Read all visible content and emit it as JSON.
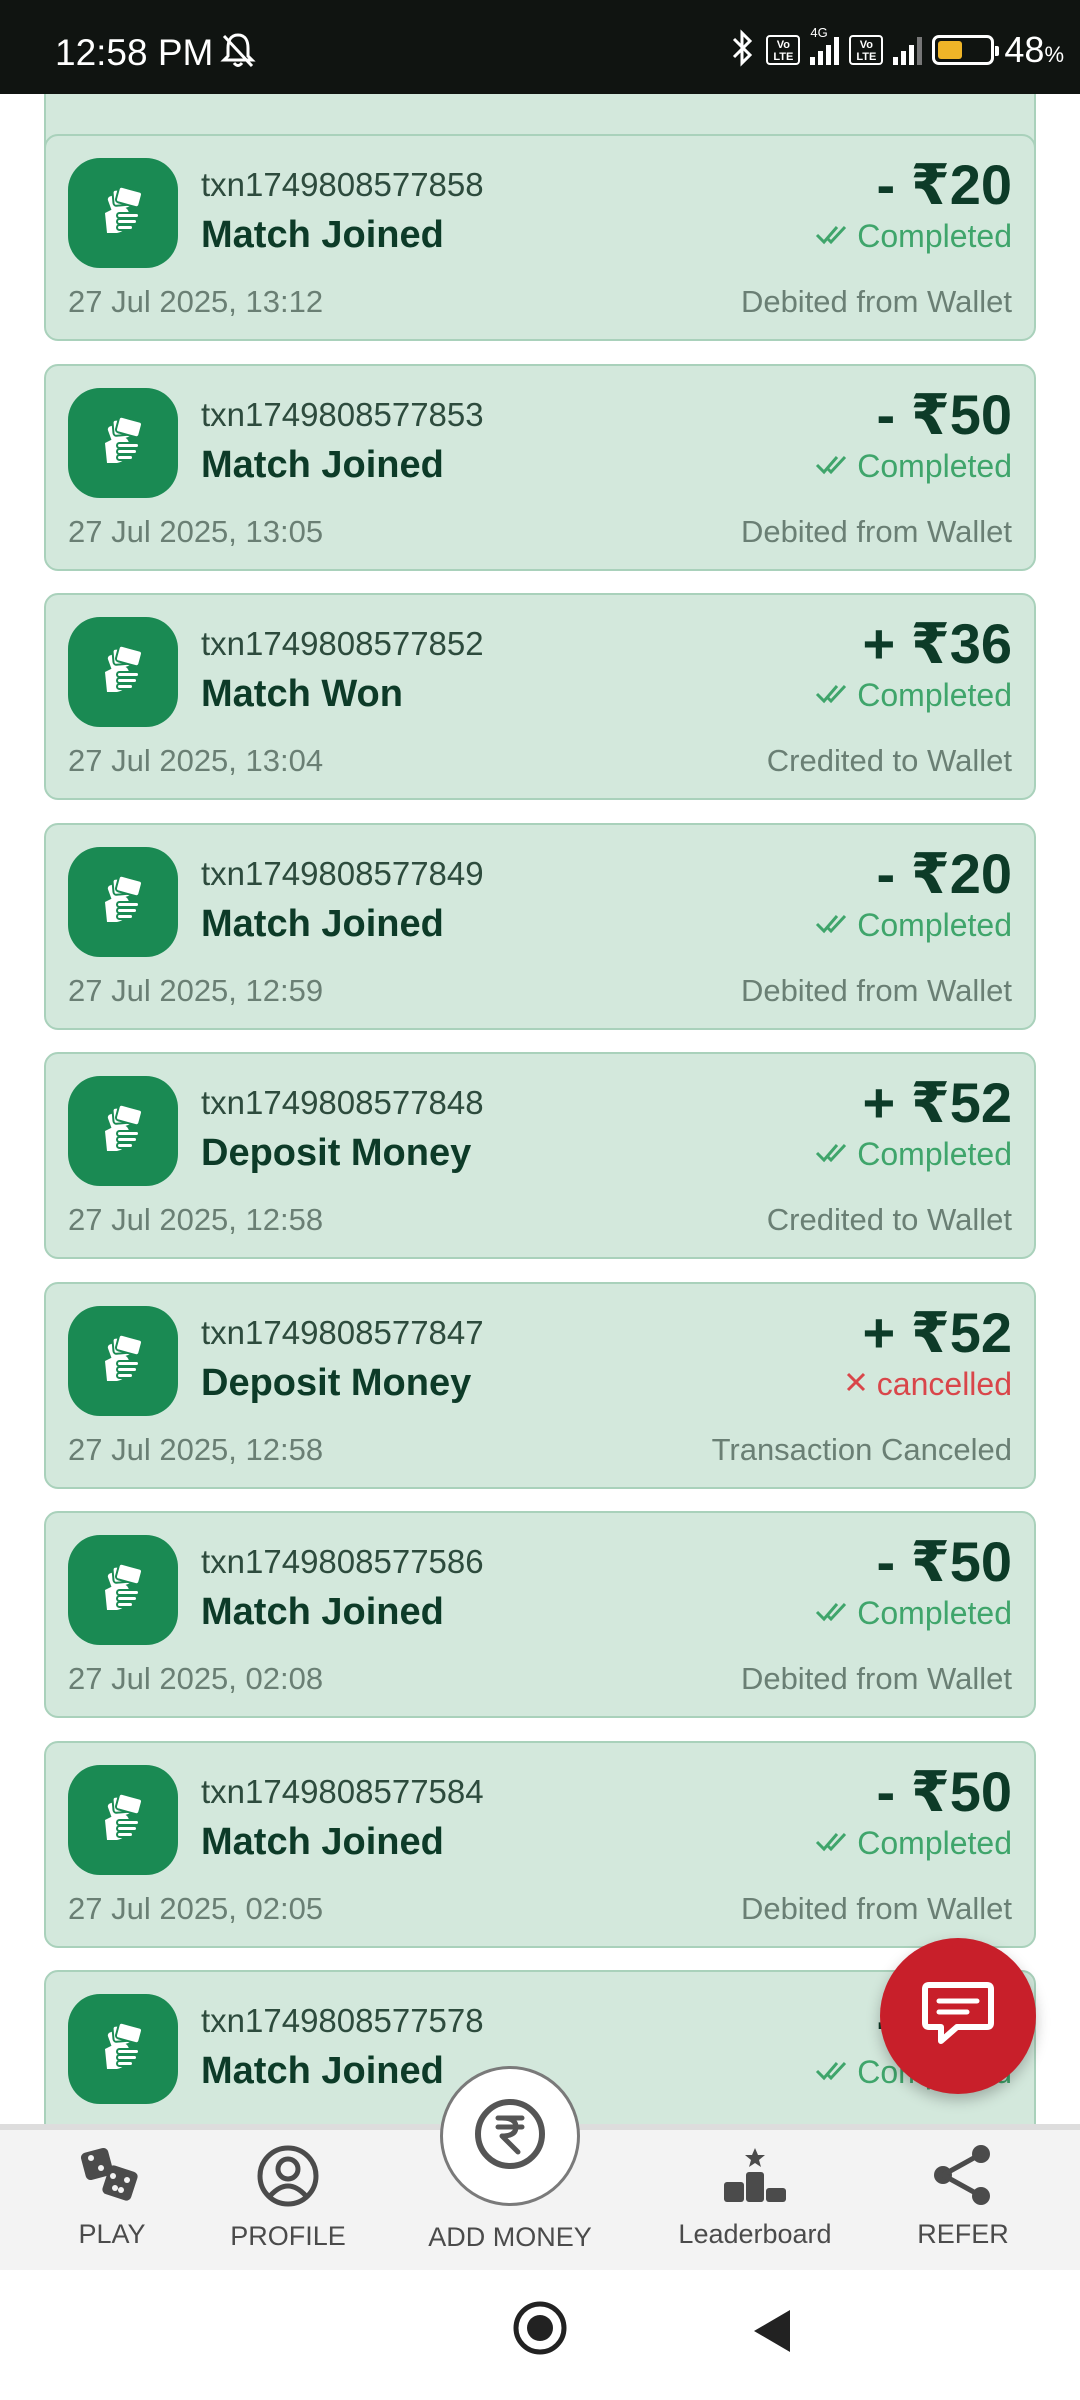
{
  "status_bar": {
    "time": "12:58 PM",
    "network": "4G",
    "volte": "Vo LTE",
    "battery_percent": "48",
    "battery_unit": "%",
    "battery_level": 0.48,
    "icons": [
      "bell-off-icon",
      "bluetooth-icon",
      "signal-icon",
      "battery-icon"
    ]
  },
  "transactions": [
    {
      "id": "txn1749808577858",
      "title": "Match Joined",
      "amount": "- ₹20",
      "status": "Completed",
      "date": "27 Jul 2025, 13:12",
      "note": "Debited from Wallet"
    },
    {
      "id": "txn1749808577853",
      "title": "Match Joined",
      "amount": "- ₹50",
      "status": "Completed",
      "date": "27 Jul 2025, 13:05",
      "note": "Debited from Wallet"
    },
    {
      "id": "txn1749808577852",
      "title": "Match Won",
      "amount": "+ ₹36",
      "status": "Completed",
      "date": "27 Jul 2025, 13:04",
      "note": "Credited to Wallet"
    },
    {
      "id": "txn1749808577849",
      "title": "Match Joined",
      "amount": "- ₹20",
      "status": "Completed",
      "date": "27 Jul 2025, 12:59",
      "note": "Debited from Wallet"
    },
    {
      "id": "txn1749808577848",
      "title": "Deposit Money",
      "amount": "+ ₹52",
      "status": "Completed",
      "date": "27 Jul 2025, 12:58",
      "note": "Credited to Wallet"
    },
    {
      "id": "txn1749808577847",
      "title": "Deposit Money",
      "amount": "+ ₹52",
      "status": "cancelled",
      "date": "27 Jul 2025, 12:58",
      "note": "Transaction Canceled"
    },
    {
      "id": "txn1749808577586",
      "title": "Match Joined",
      "amount": "- ₹50",
      "status": "Completed",
      "date": "27 Jul 2025, 02:08",
      "note": "Debited from Wallet"
    },
    {
      "id": "txn1749808577584",
      "title": "Match Joined",
      "amount": "- ₹50",
      "status": "Completed",
      "date": "27 Jul 2025, 02:05",
      "note": "Debited from Wallet"
    },
    {
      "id": "txn1749808577578",
      "title": "Match Joined",
      "amount": "- ₹50",
      "status": "Completed",
      "date": "",
      "note": ""
    }
  ],
  "bottom_nav": {
    "play": "PLAY",
    "profile": "PROFILE",
    "add_money": "ADD MONEY",
    "leaderboard": "Leaderboard",
    "refer": "REFER"
  },
  "colors": {
    "card_bg": "#d3e8dc",
    "icon_bg": "#1a8a53",
    "completed": "#3fa56b",
    "cancelled": "#d9464a",
    "fab": "#c81f2a"
  }
}
